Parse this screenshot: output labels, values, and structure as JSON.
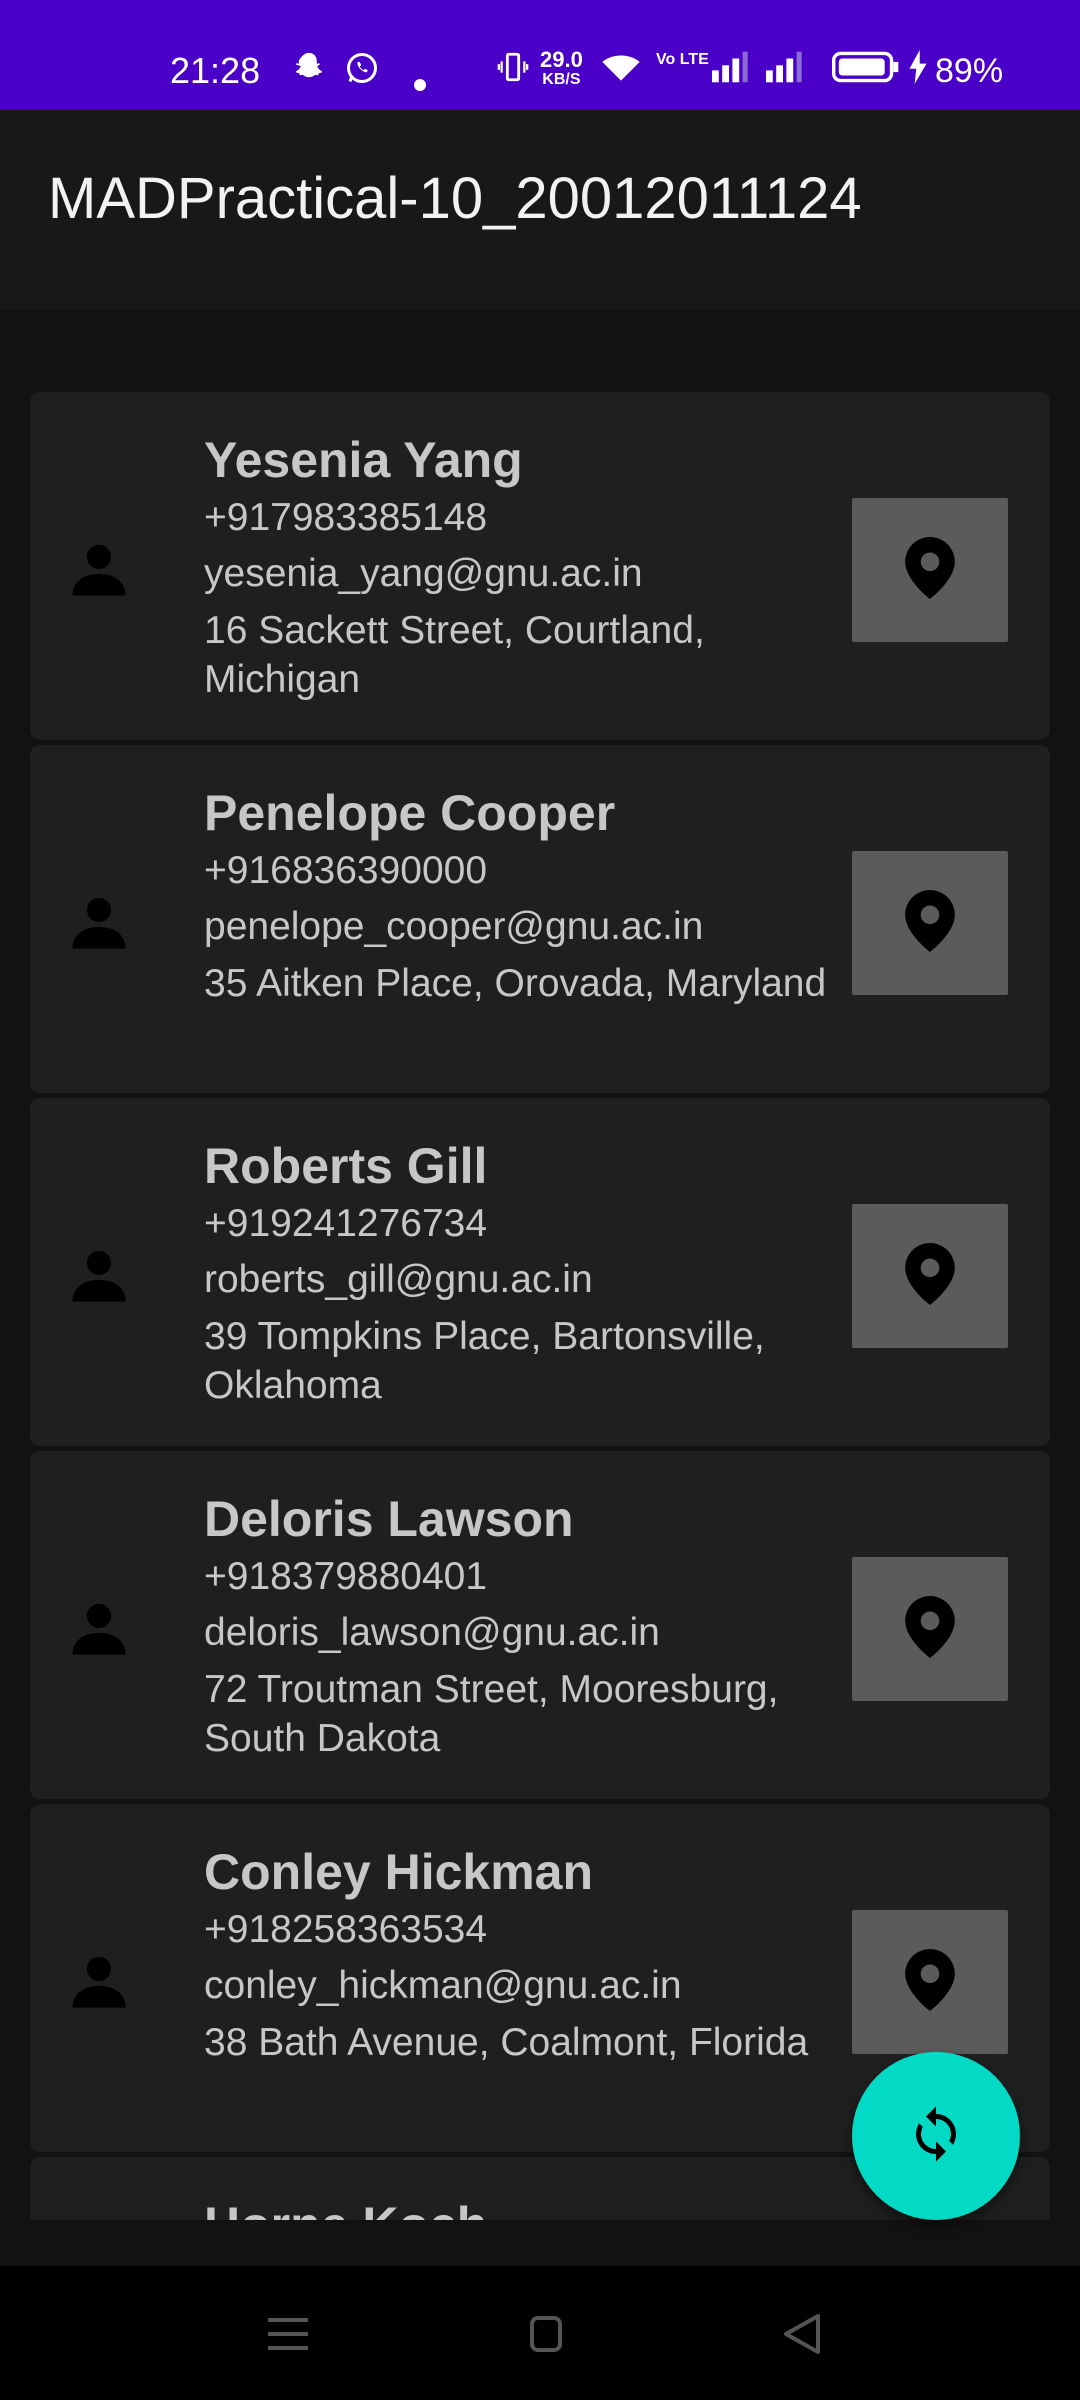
{
  "status_bar": {
    "time": "21:28",
    "network_speed_value": "29.0",
    "network_speed_unit": "KB/S",
    "volte_label": "Vo LTE",
    "battery_percent": "89%",
    "icons": [
      "snapchat-icon",
      "whatsapp-icon",
      "dot-icon",
      "vibrate-icon",
      "wifi-icon",
      "signal-icon",
      "signal-icon",
      "battery-icon",
      "charging-icon"
    ]
  },
  "app_bar": {
    "title": "MADPractical-10_20012011124"
  },
  "contacts": [
    {
      "name": "Yesenia Yang",
      "phone": "+917983385148",
      "email": "yesenia_yang@gnu.ac.in",
      "address": "16 Sackett Street, Courtland, Michigan"
    },
    {
      "name": "Penelope Cooper",
      "phone": "+916836390000",
      "email": "penelope_cooper@gnu.ac.in",
      "address": "35 Aitken Place, Orovada, Maryland"
    },
    {
      "name": "Roberts Gill",
      "phone": "+919241276734",
      "email": "roberts_gill@gnu.ac.in",
      "address": "39 Tompkins Place, Bartonsville, Oklahoma"
    },
    {
      "name": "Deloris Lawson",
      "phone": "+918379880401",
      "email": "deloris_lawson@gnu.ac.in",
      "address": "72 Troutman Street, Mooresburg, South Dakota"
    },
    {
      "name": "Conley Hickman",
      "phone": "+918258363534",
      "email": "conley_hickman@gnu.ac.in",
      "address": "38 Bath Avenue, Coalmont, Florida"
    },
    {
      "name": "Horne Koch",
      "phone": "",
      "email": "",
      "address": ""
    }
  ],
  "icons": {
    "avatar": "person-icon",
    "location_button": "location-pin-icon",
    "fab": "refresh-icon",
    "nav": [
      "menu-icon",
      "home-icon",
      "back-icon"
    ]
  },
  "colors": {
    "status_bar": "#4a00c6",
    "background": "#121212",
    "card": "#1f1f1f",
    "location_button": "#5b5b5b",
    "fab": "#03dac5",
    "text": "#c7c7c7"
  }
}
